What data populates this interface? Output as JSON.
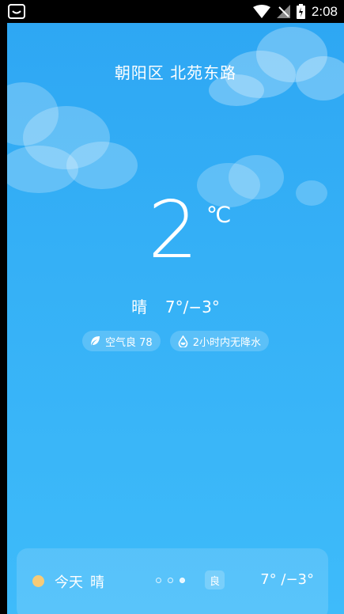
{
  "status_bar": {
    "time": "2:08",
    "icons": [
      "app-notification-icon",
      "wifi-icon",
      "signal-off-icon",
      "battery-charging-icon"
    ]
  },
  "location": "朝阳区 北苑东路",
  "current": {
    "temperature": "2",
    "unit": "℃",
    "condition": "晴",
    "range": "7°/−3°"
  },
  "chips": {
    "air_quality": "空气良 78",
    "precipitation": "2小时内无降水"
  },
  "forecast": {
    "day": "今天",
    "condition": "晴",
    "aqi_badge": "良",
    "range": "7° /−3°",
    "pages": 3,
    "active_page": 3
  },
  "colors": {
    "sky_top": "#2ea7f3",
    "sky_bottom": "#3ebbfa",
    "sun": "#f6cb78"
  }
}
